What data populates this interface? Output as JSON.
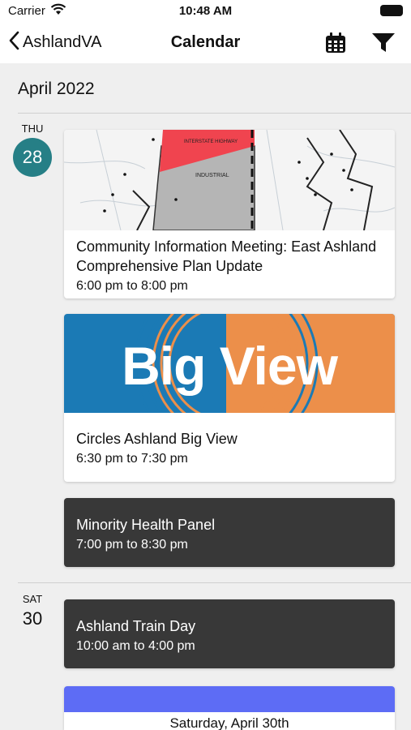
{
  "status": {
    "carrier": "Carrier",
    "time": "10:48 AM"
  },
  "nav": {
    "back_label": "AshlandVA",
    "title": "Calendar"
  },
  "month_label": "April 2022",
  "days": [
    {
      "dow": "THU",
      "date": "28",
      "events": [
        {
          "title": "Community Information Meeting: East Ashland Comprehensive Plan Update",
          "time": "6:00 pm to 8:00 pm",
          "image": "zoning-map"
        },
        {
          "title": "Circles Ashland Big View",
          "time": "6:30 pm to 7:30 pm",
          "image_text": "Big View"
        },
        {
          "title": "Minority Health Panel",
          "time": "7:00 pm to 8:30 pm"
        }
      ]
    },
    {
      "dow": "SAT",
      "date": "30",
      "events": [
        {
          "title": "Ashland Train Day",
          "time": "10:00 am to 4:00 pm"
        },
        {
          "flyer_text": "Saturday, April 30th"
        }
      ]
    }
  ],
  "map_labels": {
    "highway": "INTERSTATE HIGHWAY",
    "zone": "INDUSTRIAL"
  },
  "colors": {
    "accent": "#267f86",
    "dark_card": "#383838",
    "bigview_blue": "#1b7ab5",
    "bigview_orange": "#ec8f4a",
    "map_red": "#f0444f",
    "map_gray": "#b5b5b5"
  }
}
